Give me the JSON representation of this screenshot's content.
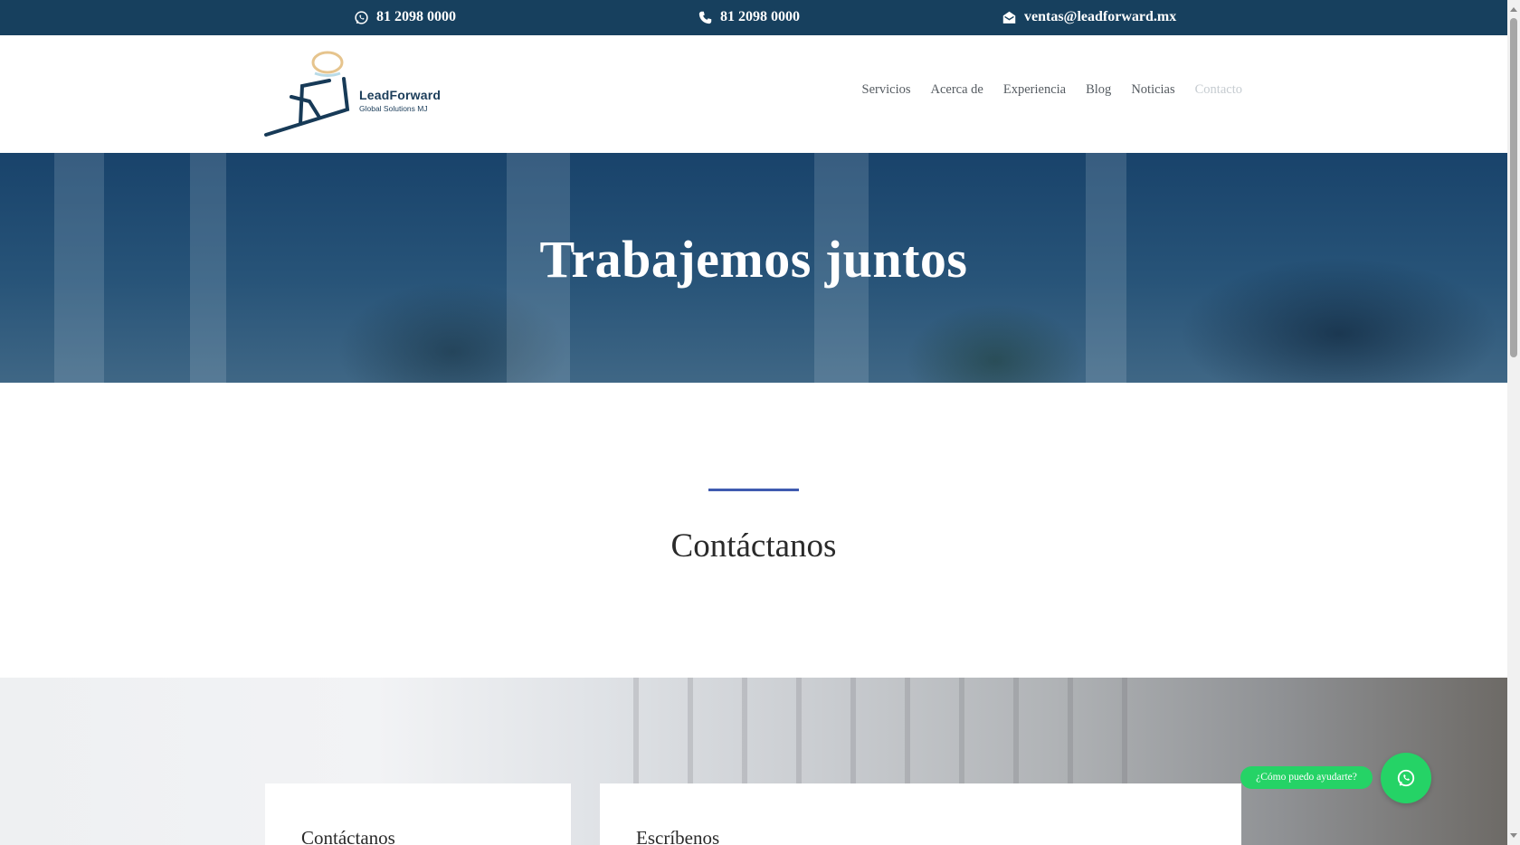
{
  "topbar": {
    "whatsapp": "81 2098 0000",
    "phone": "81 2098 0000",
    "email": "ventas@leadforward.mx"
  },
  "logo": {
    "brand": "LeadForward",
    "tagline": "Global Solutions MJ"
  },
  "nav": {
    "items": [
      {
        "label": "Servicios"
      },
      {
        "label": "Acerca de"
      },
      {
        "label": "Experiencia"
      },
      {
        "label": "Blog"
      },
      {
        "label": "Noticias"
      },
      {
        "label": "Contacto"
      }
    ],
    "active_color": "#c6ccd1"
  },
  "hero": {
    "title": "Trabajemos juntos"
  },
  "section": {
    "title": "Contáctanos",
    "accent_color": "#3f5bb0"
  },
  "cards": [
    {
      "title": "Contáctanos"
    },
    {
      "title": "Escríbenos"
    }
  ],
  "whatsapp_widget": {
    "label": "¿Cómo puedo ayudarte?",
    "color": "#25d366"
  },
  "colors": {
    "topbar_bg": "#17405e",
    "nav_text": "#555b61"
  },
  "icons": [
    "whatsapp-icon",
    "phone-icon",
    "envelope-icon"
  ]
}
